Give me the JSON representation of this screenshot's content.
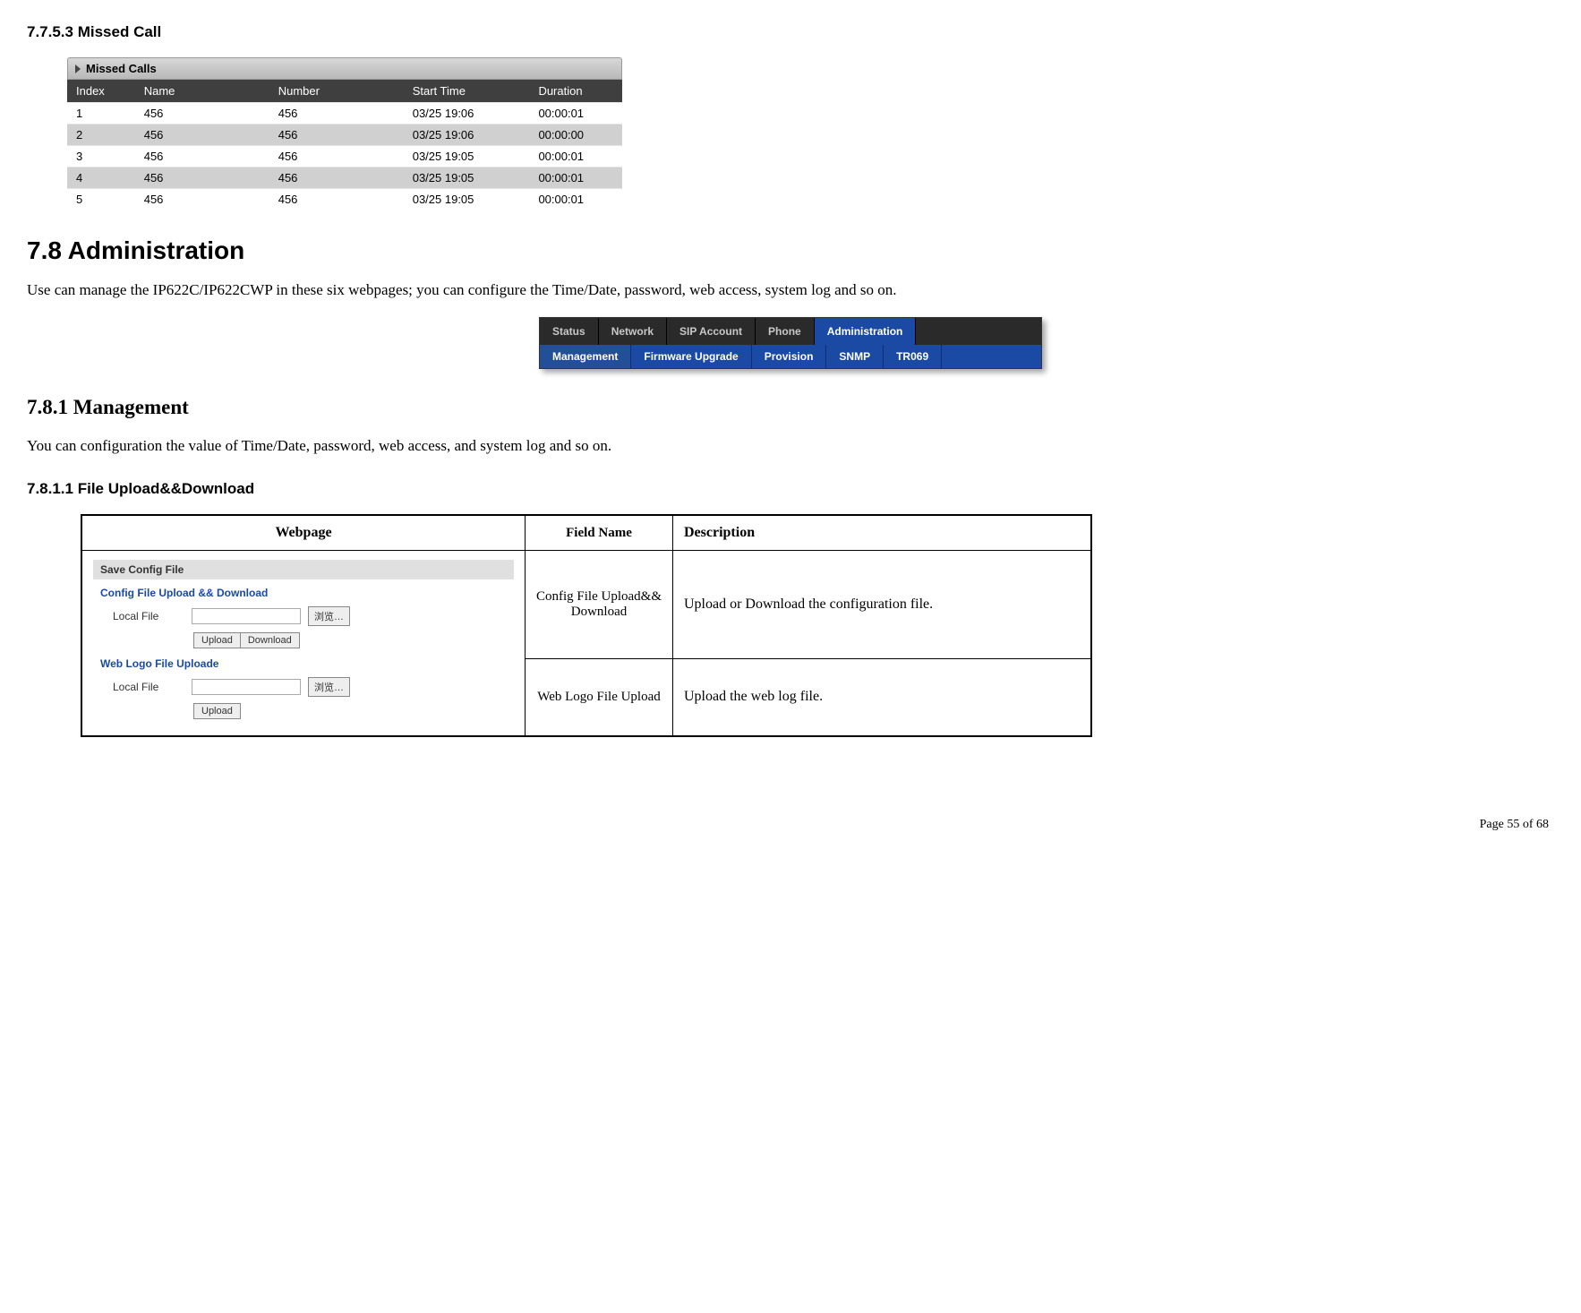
{
  "headings": {
    "h_77_5_3": "7.7.5.3  Missed Call",
    "h_7_8": "7.8    Administration",
    "h_7_8_para": "Use can manage the IP622C/IP622CWP in these six webpages; you can configure the Time/Date, password, web access, system log and so on.",
    "h_7_8_1": "7.8.1      Management",
    "h_7_8_1_para": "You can configuration the value of Time/Date, password, web access, and system log and so on.",
    "h_7_8_1_1": "7.8.1.1  File Upload&&Download"
  },
  "missed_calls": {
    "title": "Missed Calls",
    "columns": [
      "Index",
      "Name",
      "Number",
      "Start Time",
      "Duration"
    ],
    "rows": [
      {
        "index": "1",
        "name": "456",
        "number": "456",
        "start": "03/25 19:06",
        "dur": "00:00:01"
      },
      {
        "index": "2",
        "name": "456",
        "number": "456",
        "start": "03/25 19:06",
        "dur": "00:00:00"
      },
      {
        "index": "3",
        "name": "456",
        "number": "456",
        "start": "03/25 19:05",
        "dur": "00:00:01"
      },
      {
        "index": "4",
        "name": "456",
        "number": "456",
        "start": "03/25 19:05",
        "dur": "00:00:01"
      },
      {
        "index": "5",
        "name": "456",
        "number": "456",
        "start": "03/25 19:05",
        "dur": "00:00:01"
      }
    ]
  },
  "nav": {
    "top": [
      "Status",
      "Network",
      "SIP Account",
      "Phone",
      "Administration"
    ],
    "sub": [
      "Management",
      "Firmware Upgrade",
      "Provision",
      "SNMP",
      "TR069"
    ]
  },
  "desc_table": {
    "head": [
      "Webpage",
      "Field Name",
      "Description"
    ],
    "rows": [
      {
        "field": "Config File Upload&& Download",
        "desc": "Upload or Download the configuration file."
      },
      {
        "field": "Web Logo File Upload",
        "desc": "Upload the web log file."
      }
    ]
  },
  "save_config": {
    "panel_title": "Save Config File",
    "sub1": "Config File Upload && Download",
    "sub2": "Web Logo File Uploade",
    "local_file": "Local File",
    "browse": "浏览…",
    "upload": "Upload",
    "download": "Download"
  },
  "footer": "Page  55  of  68"
}
